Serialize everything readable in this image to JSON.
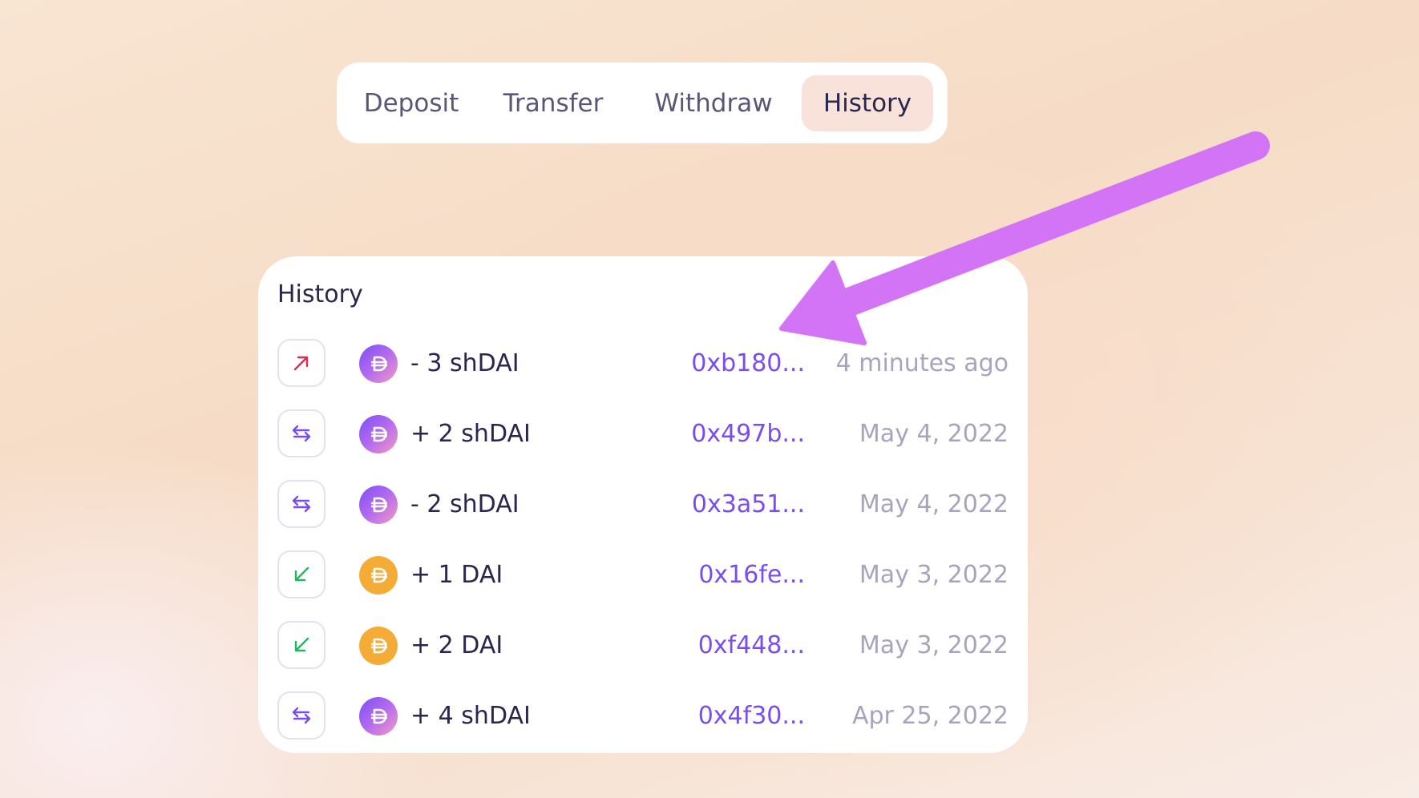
{
  "tabs": [
    {
      "label": "Deposit",
      "active": false
    },
    {
      "label": "Transfer",
      "active": false
    },
    {
      "label": "Withdraw",
      "active": false
    },
    {
      "label": "History",
      "active": true
    }
  ],
  "history": {
    "title": "History",
    "rows": [
      {
        "direction": "outgoing-arrow-icon",
        "token": "shDAI",
        "amount": "- 3 shDAI",
        "hash": "0xb180...",
        "time": "4 minutes ago"
      },
      {
        "direction": "transfer-arrows-icon",
        "token": "shDAI",
        "amount": "+ 2 shDAI",
        "hash": "0x497b...",
        "time": "May 4, 2022"
      },
      {
        "direction": "transfer-arrows-icon",
        "token": "shDAI",
        "amount": "- 2 shDAI",
        "hash": "0x3a51...",
        "time": "May 4, 2022"
      },
      {
        "direction": "incoming-arrow-icon",
        "token": "DAI",
        "amount": "+ 1 DAI",
        "hash": "0x16fe...",
        "time": "May 3, 2022"
      },
      {
        "direction": "incoming-arrow-icon",
        "token": "DAI",
        "amount": "+ 2 DAI",
        "hash": "0xf448...",
        "time": "May 3, 2022"
      },
      {
        "direction": "transfer-arrows-icon",
        "token": "shDAI",
        "amount": "+ 4 shDAI",
        "hash": "0x4f30...",
        "time": "Apr 25, 2022"
      }
    ]
  },
  "colors": {
    "outgoing": "#e5284f",
    "incoming": "#1fb85c",
    "transfer": "#7a4df3",
    "hash_link": "#7a4df3",
    "annotation_arrow": "#d274f5",
    "active_tab_bg": "#f8e2da"
  }
}
